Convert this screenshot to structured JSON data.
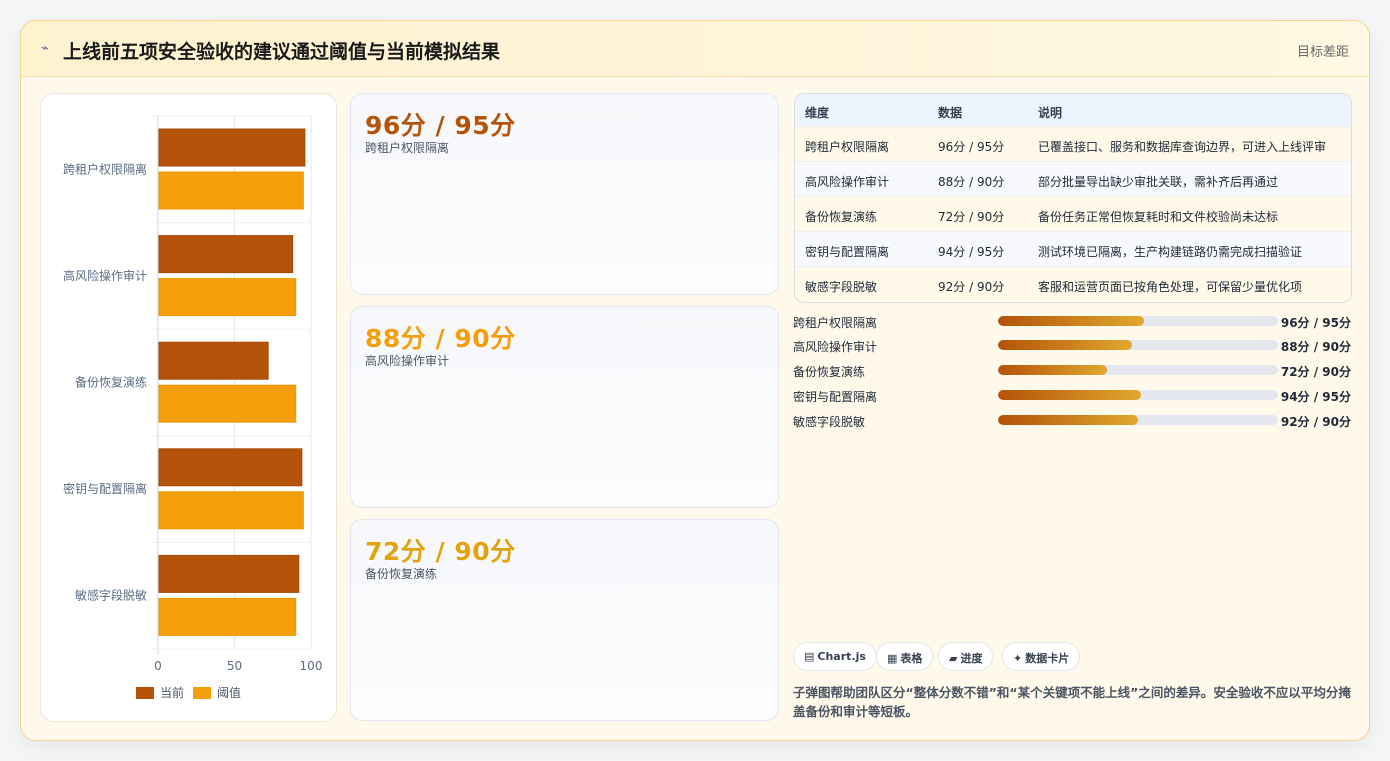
{
  "header": {
    "icon": "lightning-icon",
    "title": "上线前五项安全验收的建议通过阈值与当前模拟结果",
    "right_label": "目标差距"
  },
  "chart_data": {
    "type": "bar",
    "orientation": "horizontal",
    "categories": [
      "跨租户权限隔离",
      "高风险操作审计",
      "备份恢复演练",
      "密钥与配置隔离",
      "敏感字段脱敏"
    ],
    "series": [
      {
        "name": "当前",
        "values": [
          96,
          88,
          72,
          94,
          92
        ],
        "color": "#b45309"
      },
      {
        "name": "阈值",
        "values": [
          95,
          90,
          90,
          95,
          90
        ],
        "color": "#f59e0b"
      }
    ],
    "xlim": [
      0,
      100
    ],
    "xticks": [
      "0",
      "50",
      "100"
    ],
    "grid": true,
    "legend_position": "bottom"
  },
  "stat_cards": [
    {
      "value": "96分 / 95分",
      "label": "跨租户权限隔离",
      "color": "#b45309"
    },
    {
      "value": "88分 / 90分",
      "label": "高风险操作审计",
      "color": "#f59e0b"
    },
    {
      "value": "72分 / 90分",
      "label": "备份恢复演练",
      "color": "#e1a40f"
    }
  ],
  "table": {
    "headers": [
      "维度",
      "数据",
      "说明"
    ],
    "rows": [
      [
        "跨租户权限隔离",
        "96分 / 95分",
        "已覆盖接口、服务和数据库查询边界，可进入上线评审"
      ],
      [
        "高风险操作审计",
        "88分 / 90分",
        "部分批量导出缺少审批关联，需补齐后再通过"
      ],
      [
        "备份恢复演练",
        "72分 / 90分",
        "备份任务正常但恢复耗时和文件校验尚未达标"
      ],
      [
        "密钥与配置隔离",
        "94分 / 95分",
        "测试环境已隔离，生产构建链路仍需完成扫描验证"
      ],
      [
        "敏感字段脱敏",
        "92分 / 90分",
        "客服和运营页面已按角色处理，可保留少量优化项"
      ]
    ]
  },
  "progress": [
    {
      "label": "跨租户权限隔离",
      "value": "96分 / 95分",
      "fill": 0.52
    },
    {
      "label": "高风险操作审计",
      "value": "88分 / 90分",
      "fill": 0.48
    },
    {
      "label": "备份恢复演练",
      "value": "72分 / 90分",
      "fill": 0.39
    },
    {
      "label": "密钥与配置隔离",
      "value": "94分 / 95分",
      "fill": 0.51
    },
    {
      "label": "敏感字段脱敏",
      "value": "92分 / 90分",
      "fill": 0.5
    }
  ],
  "tags": [
    {
      "icon": "chart-icon",
      "glyph": "▤",
      "label": "Chart.js"
    },
    {
      "icon": "table-icon",
      "glyph": "▦",
      "label": "表格"
    },
    {
      "icon": "progress-icon",
      "glyph": "▰",
      "label": "进度"
    },
    {
      "icon": "sparkle-icon",
      "glyph": "✦",
      "label": "数据卡片"
    }
  ],
  "note": "子弹图帮助团队区分“整体分数不错”和“某个关键项不能上线”之间的差异。安全验收不应以平均分掩盖备份和审计等短板。"
}
